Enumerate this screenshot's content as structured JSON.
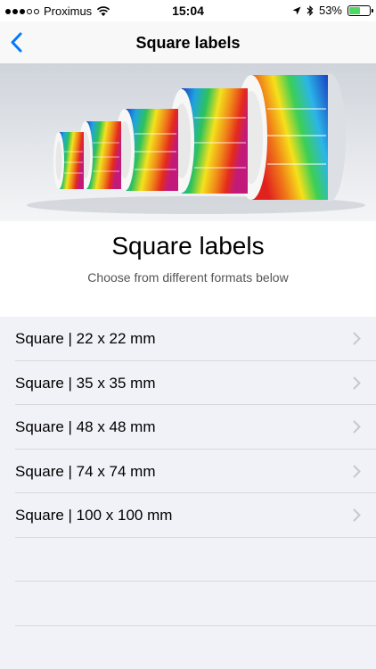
{
  "status_bar": {
    "carrier": "Proximus",
    "time": "15:04",
    "battery_percent": "53%",
    "battery_level": 0.53,
    "signal_bars_filled": 3,
    "signal_bars_total": 5
  },
  "nav": {
    "title": "Square labels",
    "back_icon": "chevron-left-icon"
  },
  "header": {
    "title": "Square labels",
    "subtitle": "Choose from different formats below"
  },
  "formats": [
    {
      "label": "Square | 22 x 22 mm"
    },
    {
      "label": "Square | 35 x 35 mm"
    },
    {
      "label": "Square | 48 x 48 mm"
    },
    {
      "label": "Square | 74 x 74 mm"
    },
    {
      "label": "Square | 100 x 100 mm"
    }
  ],
  "colors": {
    "accent": "#007aff",
    "list_background": "#f1f1f8",
    "separator": "#d7d7dd",
    "battery_fill": "#4cd964"
  }
}
